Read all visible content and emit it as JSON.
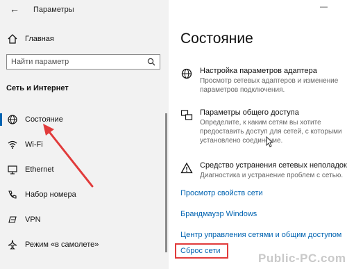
{
  "window": {
    "title": "Параметры",
    "minimize_glyph": "—"
  },
  "sidebar": {
    "home_label": "Главная",
    "search_placeholder": "Найти параметр",
    "section_title": "Сеть и Интернет",
    "items": [
      {
        "label": "Состояние",
        "icon": "globe-icon",
        "selected": true
      },
      {
        "label": "Wi-Fi",
        "icon": "wifi-icon",
        "selected": false
      },
      {
        "label": "Ethernet",
        "icon": "ethernet-icon",
        "selected": false
      },
      {
        "label": "Набор номера",
        "icon": "phone-icon",
        "selected": false
      },
      {
        "label": "VPN",
        "icon": "vpn-icon",
        "selected": false
      },
      {
        "label": "Режим «в самолете»",
        "icon": "airplane-icon",
        "selected": false
      }
    ]
  },
  "main": {
    "title": "Состояние",
    "entries": [
      {
        "title": "Настройка параметров адаптера",
        "description": "Просмотр сетевых адаптеров и изменение параметров подключения.",
        "icon": "adapter-icon"
      },
      {
        "title": "Параметры общего доступа",
        "description": "Определите, к каким сетям вы хотите предоставить доступ для сетей, с которыми установлено соединение.",
        "icon": "sharing-icon"
      },
      {
        "title": "Средство устранения сетевых неполадок",
        "description": "Диагностика и устранение проблем с сетью.",
        "icon": "warning-icon"
      }
    ],
    "links": [
      "Просмотр свойств сети",
      "Брандмауэр Windows",
      "Центр управления сетями и общим доступом",
      "Сброс сети"
    ]
  },
  "watermark": "Public-PC.com",
  "colors": {
    "accent": "#0063b1",
    "highlight": "#e13b3b",
    "sidebar_bg": "#f2f2f2"
  }
}
